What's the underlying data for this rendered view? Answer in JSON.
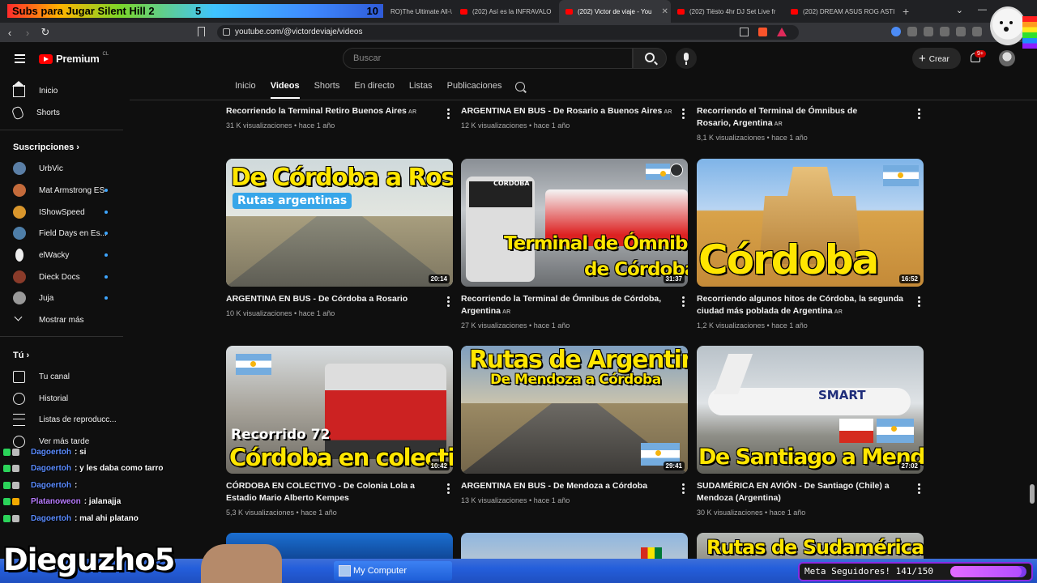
{
  "subs_goal": {
    "title": "Subs para Jugar Silent Hill 2",
    "current": "5",
    "goal": "10"
  },
  "browser": {
    "tabs": [
      {
        "label": "RO)The Ultimate All-\\",
        "active": false
      },
      {
        "label": "(202) Así es la INFRAVALO",
        "active": false
      },
      {
        "label": "(202) Victor de viaje - You",
        "active": true
      },
      {
        "label": "(202) Tiësto 4hr DJ Set Live fr",
        "active": false
      },
      {
        "label": "(202) DREAM ASUS ROG ASTI",
        "active": false
      }
    ],
    "url": "youtube.com/@victordeviaje/videos"
  },
  "header": {
    "logo_text": "Premium",
    "region": "CL",
    "search_placeholder": "Buscar",
    "create_label": "Crear",
    "notifications": "9+"
  },
  "sidebar": {
    "main": [
      {
        "label": "Inicio",
        "icon": "home-icon"
      },
      {
        "label": "Shorts",
        "icon": "shorts-icon"
      }
    ],
    "subscriptions_heading": "Suscripciones",
    "subscriptions": [
      {
        "label": "UrbVic",
        "color": "#5b7fa6",
        "new": false
      },
      {
        "label": "Mat Armstrong ES",
        "color": "#c46b3b",
        "new": true
      },
      {
        "label": "IShowSpeed",
        "color": "#d9962c",
        "new": true
      },
      {
        "label": "Field Days en Es...",
        "color": "#4e7ea8",
        "new": true
      },
      {
        "label": "elWacky",
        "color": "#eeeeee",
        "new": true
      },
      {
        "label": "Dieck Docs",
        "color": "#8a3b2a",
        "new": true
      },
      {
        "label": "Juja",
        "color": "#999999",
        "new": true
      }
    ],
    "show_more": "Mostrar más",
    "you_heading": "Tú",
    "you_items": [
      {
        "label": "Tu canal",
        "icon": "channel-icon"
      },
      {
        "label": "Historial",
        "icon": "history-icon"
      },
      {
        "label": "Listas de reproducc...",
        "icon": "playlists-icon"
      },
      {
        "label": "Ver más tarde",
        "icon": "watch-later-icon"
      }
    ]
  },
  "channel_tabs": [
    "Inicio",
    "Videos",
    "Shorts",
    "En directo",
    "Listas",
    "Publicaciones"
  ],
  "videos": [
    {
      "title": "Recorriendo la Terminal Retiro Buenos Aires",
      "ar": "AR",
      "views": "31 K visualizaciones",
      "age": "hace 1 año"
    },
    {
      "title": "ARGENTINA EN BUS - De Rosario a Buenos Aires",
      "ar": "AR",
      "views": "12 K visualizaciones",
      "age": "hace 1 año"
    },
    {
      "title": "Recorriendo el Terminal de Ómnibus de Rosario, Argentina",
      "ar": "AR",
      "views": "8,1 K visualizaciones",
      "age": "hace 1 año"
    },
    {
      "title": "ARGENTINA EN BUS - De Córdoba a Rosario",
      "ar": "",
      "views": "10 K visualizaciones",
      "age": "hace 1 año",
      "duration": "20:14",
      "thumb_title": "De Córdoba a Rosario",
      "thumb_sub": "Rutas argentinas"
    },
    {
      "title": "Recorriendo la Terminal de Ómnibus de Córdoba, Argentina",
      "ar": "AR",
      "views": "27 K visualizaciones",
      "age": "hace 1 año",
      "duration": "31:37",
      "thumb_title": "Terminal de Ómnibus",
      "thumb_title2": "de Córdoba",
      "thumb_sign": "CORDOBA"
    },
    {
      "title": "Recorriendo algunos hitos de Córdoba, la segunda ciudad más poblada de Argentina",
      "ar": "AR",
      "views": "1,2 K visualizaciones",
      "age": "hace 1 año",
      "duration": "16:52",
      "thumb_title": "Córdoba"
    },
    {
      "title": "CÓRDOBA EN COLECTIVO - De Colonia Lola a Estadio Mario Alberto Kempes",
      "ar": "",
      "views": "5,3 K visualizaciones",
      "age": "hace 1 año",
      "duration": "10:42",
      "thumb_title": "Córdoba en colectivo",
      "thumb_sub": "Recorrido 72"
    },
    {
      "title": "ARGENTINA EN BUS - De Mendoza a Córdoba",
      "ar": "",
      "views": "13 K visualizaciones",
      "age": "hace 1 año",
      "duration": "29:41",
      "thumb_title": "Rutas de Argentina",
      "thumb_sub": "De Mendoza a Córdoba"
    },
    {
      "title": "SUDAMÉRICA EN AVIÓN - De Santiago (Chile) a Mendoza (Argentina)",
      "ar": "",
      "views": "30 K visualizaciones",
      "age": "hace 1 año",
      "duration": "27:02",
      "thumb_title": "De Santiago a Mendoza",
      "thumb_brand": "SMART"
    },
    {
      "thumb_title": ""
    },
    {
      "thumb_title": ""
    },
    {
      "thumb_title": "Rutas de Sudamérica"
    }
  ],
  "chat": [
    {
      "user": "Dagoertoh",
      "msg": ": si",
      "alt": false
    },
    {
      "user": "Dagoertoh",
      "msg": ": y les daba como tarro",
      "alt": false
    },
    {
      "user": "Dagoertoh",
      "msg": ":",
      "alt": false
    },
    {
      "user": "Platanoweon",
      "msg": ": jalanajja",
      "alt": true
    },
    {
      "user": "Dagoertoh",
      "msg": ": mal ahi platano",
      "alt": false
    }
  ],
  "streamer_name": "Dieguzho5",
  "taskbar": {
    "window_label": "My Computer"
  },
  "goal_meta": {
    "label": "Meta Seguidores! 141/150",
    "progress": 0.94
  }
}
